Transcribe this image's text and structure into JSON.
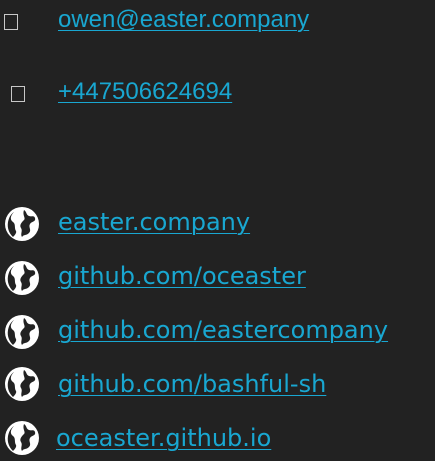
{
  "contacts": {
    "email": {
      "icon": "envelope-icon",
      "text": "owen@easter.company"
    },
    "phone": {
      "icon": "phone-icon",
      "text": "+447506624694"
    }
  },
  "links": [
    {
      "icon": "globe-icon",
      "text": "easter.company"
    },
    {
      "icon": "globe-icon",
      "text": "github.com/oceaster"
    },
    {
      "icon": "globe-icon",
      "text": "github.com/eastercompany"
    },
    {
      "icon": "globe-icon",
      "text": "github.com/bashful-sh"
    },
    {
      "icon": "globe-icon",
      "text": "oceaster.github.io"
    }
  ],
  "colors": {
    "background": "#222222",
    "link": "#19a7d1",
    "icon": "#ffffff"
  }
}
